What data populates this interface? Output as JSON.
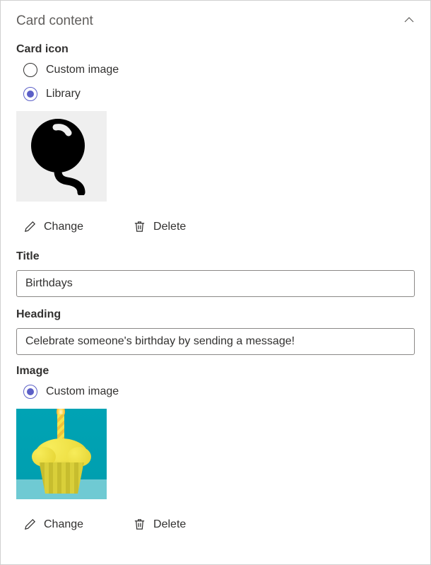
{
  "panel": {
    "title": "Card content"
  },
  "cardIcon": {
    "label": "Card icon",
    "options": {
      "custom": "Custom image",
      "library": "Library"
    },
    "selected": "library",
    "previewIcon": "balloon-icon",
    "actions": {
      "change": "Change",
      "delete": "Delete"
    }
  },
  "titleField": {
    "label": "Title",
    "value": "Birthdays"
  },
  "headingField": {
    "label": "Heading",
    "value": "Celebrate someone's birthday by sending a message!"
  },
  "imageSection": {
    "label": "Image",
    "options": {
      "custom": "Custom image"
    },
    "selected": "custom",
    "previewDescription": "yellow-cupcake-with-candle-on-teal-background",
    "actions": {
      "change": "Change",
      "delete": "Delete"
    }
  }
}
